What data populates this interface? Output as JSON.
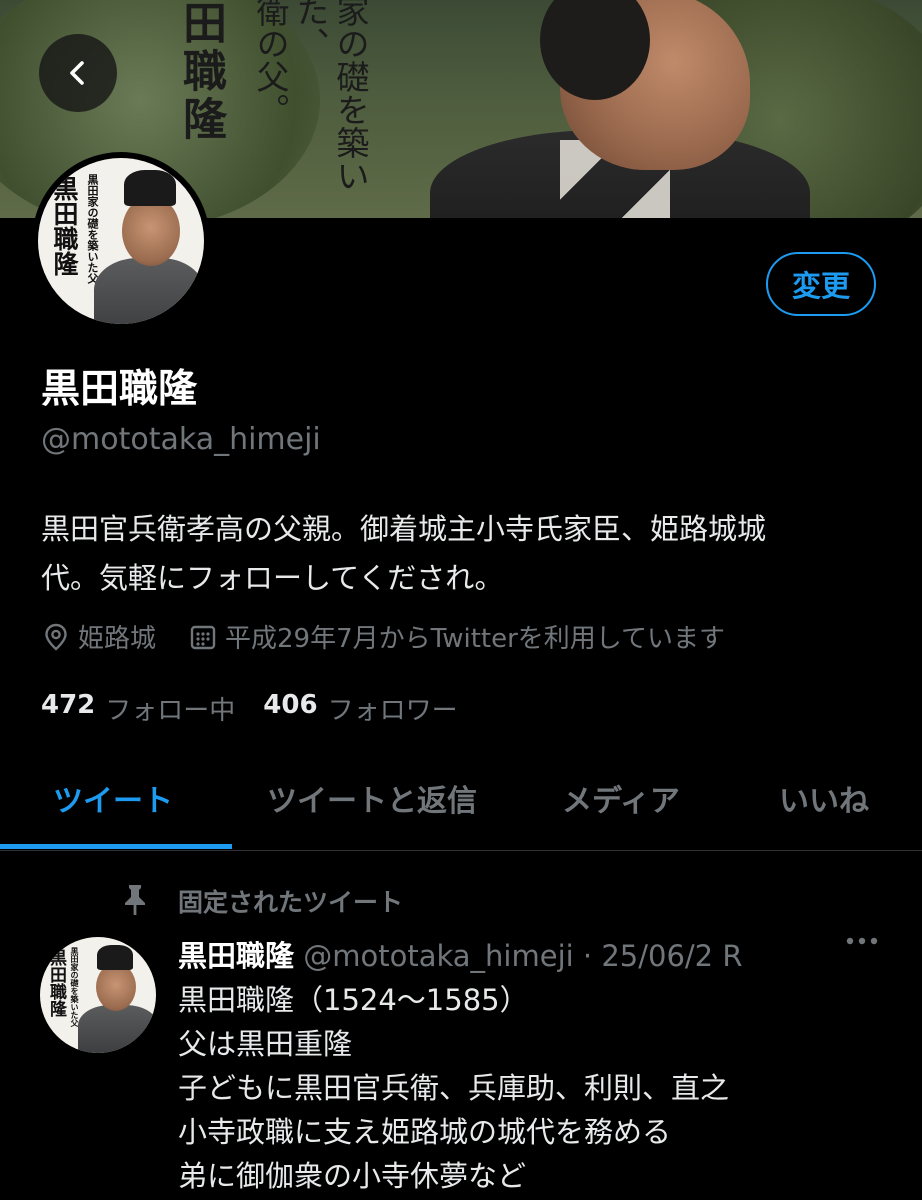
{
  "banner": {
    "poster_big": "田職隆",
    "poster_col1": "家の礎を築いた、",
    "poster_col2": "衛の父。"
  },
  "avatar": {
    "text_small": "黒田家の礎を築いた父",
    "text_big": "黒田職隆"
  },
  "header": {
    "edit_label": "変更"
  },
  "profile": {
    "name": "黒田職隆",
    "handle": "@mototaka_himeji",
    "bio_line1": "黒田官兵衛孝高の父親。御着城主小寺氏家臣、姫路城城",
    "bio_line2": "代。気軽にフォローしてくだされ。",
    "location": "姫路城",
    "joined": "平成29年7月からTwitterを利用しています",
    "following_count": "472",
    "following_label": "フォロー中",
    "followers_count": "406",
    "followers_label": "フォロワー"
  },
  "tabs": [
    {
      "label": "ツイート"
    },
    {
      "label": "ツイートと返信"
    },
    {
      "label": "メディア"
    },
    {
      "label": "いいね"
    }
  ],
  "tweet": {
    "pinned_label": "固定されたツイート",
    "author_name": "黒田職隆",
    "author_meta": "@mototaka_himeji · 25/06/2 R",
    "lines": [
      "黒田職隆（1524～1585）",
      "父は黒田重隆",
      "子どもに黒田官兵衛、兵庫助、利則、直之",
      "小寺政職に支え姫路城の城代を務める",
      "弟に御伽衆の小寺休夢など"
    ]
  },
  "colors": {
    "accent": "#1d9bf0",
    "background": "#000000",
    "secondary_text": "#71767b"
  },
  "icons": [
    "back-arrow-icon",
    "location-pin-icon",
    "calendar-icon",
    "pin-icon",
    "more-icon"
  ]
}
